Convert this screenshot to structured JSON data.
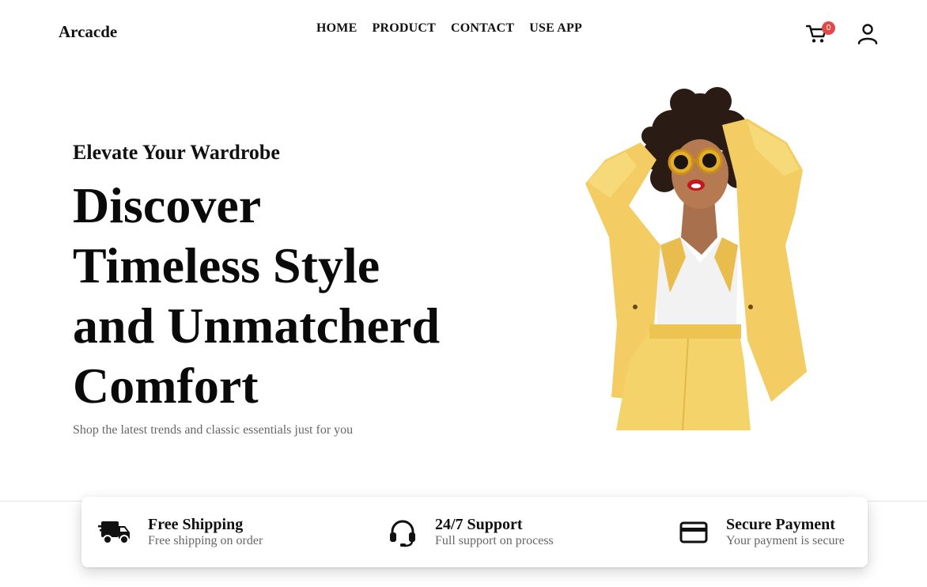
{
  "header": {
    "brand": "Arcacde",
    "nav": [
      "HOME",
      "PRODUCT",
      "CONTACT",
      "USE APP"
    ],
    "cart_icon": "cart-icon",
    "cart_count": "0",
    "cart_badge_color": "#e04a4a",
    "user_icon": "user-icon"
  },
  "hero": {
    "eyebrow": "Elevate Your Wardrobe",
    "title_lines": [
      "Discover",
      "Timeless Style",
      "and Unmatcherd",
      "Comfort"
    ],
    "subtitle": "Shop the latest trends and classic essentials just for you",
    "image_subject": "model-in-yellow-suit",
    "accent_color": "#f5d36b"
  },
  "features": [
    {
      "icon": "delivery-truck-icon",
      "title": "Free Shipping",
      "desc": "Free shipping on order"
    },
    {
      "icon": "headset-icon",
      "title": "24/7 Support",
      "desc": "Full support on process"
    },
    {
      "icon": "credit-card-icon",
      "title": "Secure Payment",
      "desc": "Your payment is secure"
    }
  ]
}
